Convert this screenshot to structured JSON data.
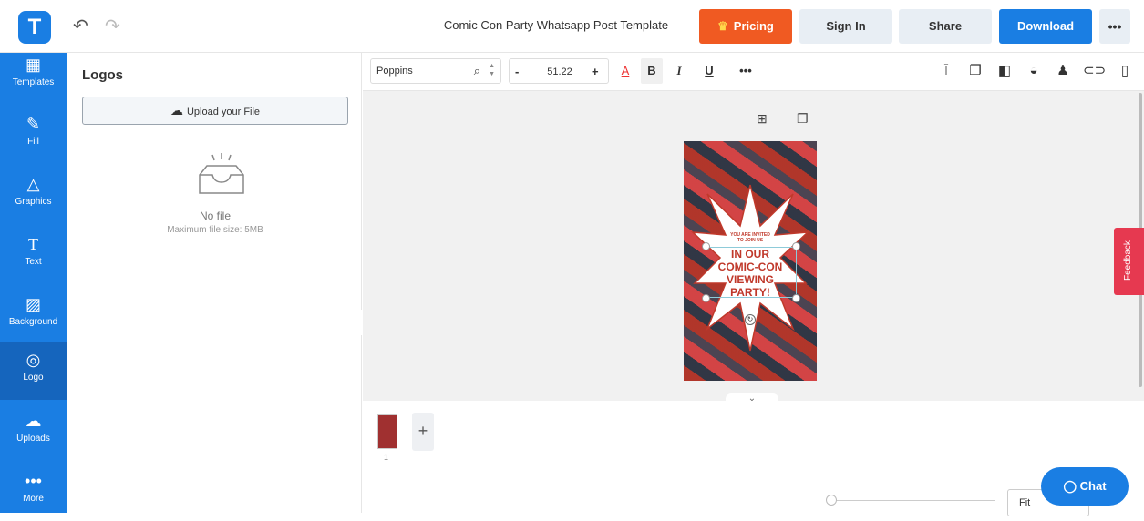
{
  "header": {
    "logo_letter": "T",
    "title": "Comic Con Party Whatsapp Post Template",
    "pricing_label": "Pricing",
    "signin_label": "Sign In",
    "share_label": "Share",
    "download_label": "Download",
    "more_label": "•••"
  },
  "sidebar": {
    "items": [
      {
        "label": "Templates",
        "icon": "templates-icon"
      },
      {
        "label": "Fill",
        "icon": "fill-icon"
      },
      {
        "label": "Graphics",
        "icon": "graphics-icon"
      },
      {
        "label": "Text",
        "icon": "text-icon"
      },
      {
        "label": "Background",
        "icon": "background-icon"
      },
      {
        "label": "Logo",
        "icon": "logo-icon",
        "active": true
      },
      {
        "label": "Uploads",
        "icon": "uploads-icon"
      },
      {
        "label": "More",
        "icon": "more-icon"
      }
    ]
  },
  "panel": {
    "title": "Logos",
    "upload_label": "Upload your File",
    "empty_title": "No file",
    "empty_sub": "Maximum file size: 5MB"
  },
  "toolbar": {
    "font": "Poppins",
    "minus": "-",
    "size": "51.22",
    "plus": "+",
    "color_a": "A",
    "bold": "B",
    "italic": "I",
    "underline": "U",
    "more": "•••"
  },
  "poster": {
    "small_line1": "YOU ARE INVITED",
    "small_line2": "TO JOIN US",
    "big_line1": "IN OUR",
    "big_line2": "COMIC-CON",
    "big_line3": "VIEWING",
    "big_line4": "PARTY!"
  },
  "thumbs": {
    "page_number": "1",
    "add": "+"
  },
  "zoom": {
    "fit_label": "Fit"
  },
  "chat_label": "Chat",
  "feedback_label": "Feedback",
  "colors": {
    "brand_blue": "#1a7ee3",
    "pricing_orange": "#f05a22",
    "feedback_red": "#e63950"
  }
}
